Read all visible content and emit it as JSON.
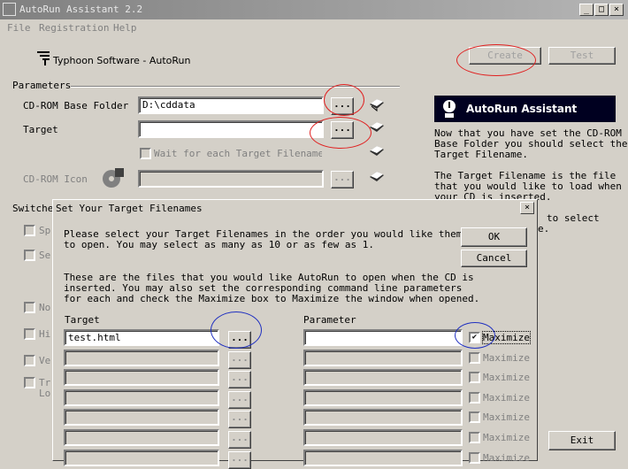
{
  "window": {
    "title": "AutoRun Assistant 2.2",
    "min_glyph": "_",
    "max_glyph": "□",
    "close_glyph": "×"
  },
  "menu": {
    "file": "File",
    "registration": "Registration",
    "help": "Help"
  },
  "header": {
    "brand": "Typhoon Software - AutoRun",
    "create_label": "Create",
    "test_label": "Test"
  },
  "parameters": {
    "group_label": "Parameters",
    "base_folder_label": "CD-ROM Base Folder",
    "base_folder_value": "D:\\cddata",
    "target_label": "Target",
    "target_value": "",
    "wait_label": "Wait for each Target Filename to",
    "icon_label": "CD-ROM Icon",
    "icon_value": "",
    "browse_label": "..."
  },
  "switches": {
    "label": "Switche",
    "items": [
      "Sp",
      "Se",
      "No",
      "Hi",
      "Ve",
      "Tr"
    ],
    "extra": "Lo"
  },
  "side_panel": {
    "title": "AutoRun Assistant",
    "para1_l1": "Now that you have set the CD-ROM",
    "para1_l2": "Base Folder you should select the",
    "para1_l3": "Target Filename.",
    "para2_l1": "The Target Filename is the file",
    "para2_l2": "that you would like to load when",
    "para2_l3": "your CD is inserted.",
    "para3_l1": "to select",
    "para3_l2": "e.",
    "exit_label": "Exit"
  },
  "dialog": {
    "title": "Set Your Target Filenames",
    "close_glyph": "×",
    "intro_l1": "Please select your Target Filenames in the order you would like them",
    "intro_l2": "to open. You may select as many as 10 or as few as 1.",
    "desc_l1": "These are the files that you would like AutoRun to open when the CD is",
    "desc_l2": "inserted. You may also set the corresponding command line parameters",
    "desc_l3": "for each and check the Maximize box to Maximize the window when opened.",
    "ok_label": "OK",
    "cancel_label": "Cancel",
    "target_header": "Target",
    "parameter_header": "Parameter",
    "maximize_label": "Maximize",
    "check_glyph": "✔",
    "first_target": "test.html"
  }
}
